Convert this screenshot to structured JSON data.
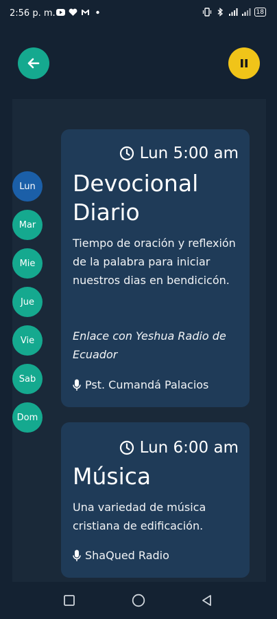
{
  "status_bar": {
    "time": "2:56 p. m.",
    "left_icons": [
      "youtube-icon",
      "heart-icon",
      "gmail-icon",
      "dot-icon"
    ],
    "right_icons": [
      "vibrate-icon",
      "bluetooth-icon",
      "signal-icon",
      "signal-2-icon"
    ],
    "battery": "18"
  },
  "header": {
    "back_icon": "arrow-left-icon",
    "pause_icon": "pause-icon"
  },
  "days": [
    {
      "label": "Lun",
      "active": true
    },
    {
      "label": "Mar",
      "active": false
    },
    {
      "label": "Mie",
      "active": false
    },
    {
      "label": "Jue",
      "active": false
    },
    {
      "label": "Vie",
      "active": false
    },
    {
      "label": "Sab",
      "active": false
    },
    {
      "label": "Dom",
      "active": false
    }
  ],
  "programs": [
    {
      "time": "Lun 5:00 am",
      "title_line1": "Devocional",
      "title_line2": "Diario",
      "description": "Tiempo de oración y reflexión de la palabra para iniciar nuestros dias en bendicicón.",
      "link": "Enlace con Yeshua Radio de Ecuador",
      "host": "Pst. Cumandá Palacios"
    },
    {
      "time": "Lun 6:00 am",
      "title_line1": "Música",
      "description": "Una variedad de música cristiana de edificación.",
      "host": "ShaQued Radio"
    }
  ],
  "colors": {
    "background": "#142232",
    "panel": "#1a2939",
    "card": "#1f3b58",
    "teal": "#15a98f",
    "active_day": "#1b5fa8",
    "pause": "#f0c419"
  }
}
